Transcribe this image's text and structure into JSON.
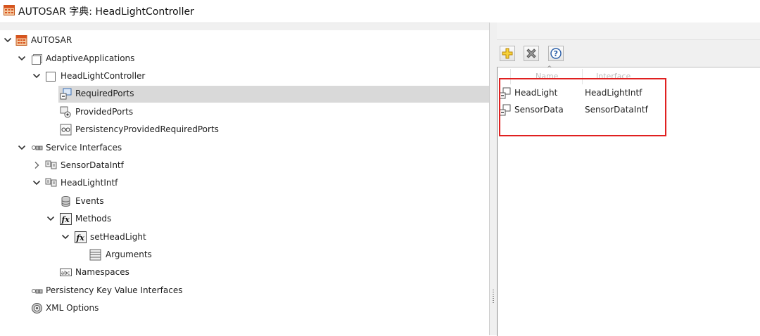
{
  "window": {
    "title": "AUTOSAR 字典: HeadLightController",
    "app_icon": "autosar-dictionary-icon"
  },
  "tree": {
    "root": {
      "label": "AUTOSAR",
      "icon": "autosar-root-icon"
    },
    "adaptive_applications": {
      "label": "AdaptiveApplications",
      "icon": "folder-box-icon"
    },
    "headlight_controller": {
      "label": "HeadLightController",
      "icon": "component-box-icon"
    },
    "required_ports": {
      "label": "RequiredPorts",
      "icon": "required-ports-icon",
      "selected": true
    },
    "provided_ports": {
      "label": "ProvidedPorts",
      "icon": "provided-ports-icon"
    },
    "persistency_ports": {
      "label": "PersistencyProvidedRequiredPorts",
      "icon": "persistency-ports-icon"
    },
    "service_interfaces": {
      "label": "Service Interfaces",
      "icon": "service-interfaces-icon"
    },
    "sensor_data_intf": {
      "label": "SensorDataIntf",
      "icon": "interface-icon"
    },
    "headlight_intf": {
      "label": "HeadLightIntf",
      "icon": "interface-icon"
    },
    "events": {
      "label": "Events",
      "icon": "events-database-icon"
    },
    "methods": {
      "label": "Methods",
      "icon": "fx-function-icon"
    },
    "set_headlight": {
      "label": "setHeadLight",
      "icon": "fx-function-icon"
    },
    "arguments": {
      "label": "Arguments",
      "icon": "arguments-list-icon"
    },
    "namespaces": {
      "label": "Namespaces",
      "icon": "abc-namespace-icon"
    },
    "persistency_kv": {
      "label": "Persistency Key Value Interfaces",
      "icon": "persistency-interfaces-icon"
    },
    "xml_options": {
      "label": "XML Options",
      "icon": "gear-icon"
    }
  },
  "toolbar": {
    "add_icon": "plus-icon",
    "delete_icon": "delete-x-icon",
    "help_icon": "help-question-icon"
  },
  "table": {
    "headers": {
      "name": "Name",
      "interface": "Interface"
    },
    "rows": [
      {
        "name": "HeadLight",
        "interface": "HeadLightIntf",
        "icon": "port-icon"
      },
      {
        "name": "SensorData",
        "interface": "SensorDataIntf",
        "icon": "port-icon"
      }
    ]
  },
  "colors": {
    "highlight": "#e02020",
    "selection": "#d9d9d9"
  }
}
